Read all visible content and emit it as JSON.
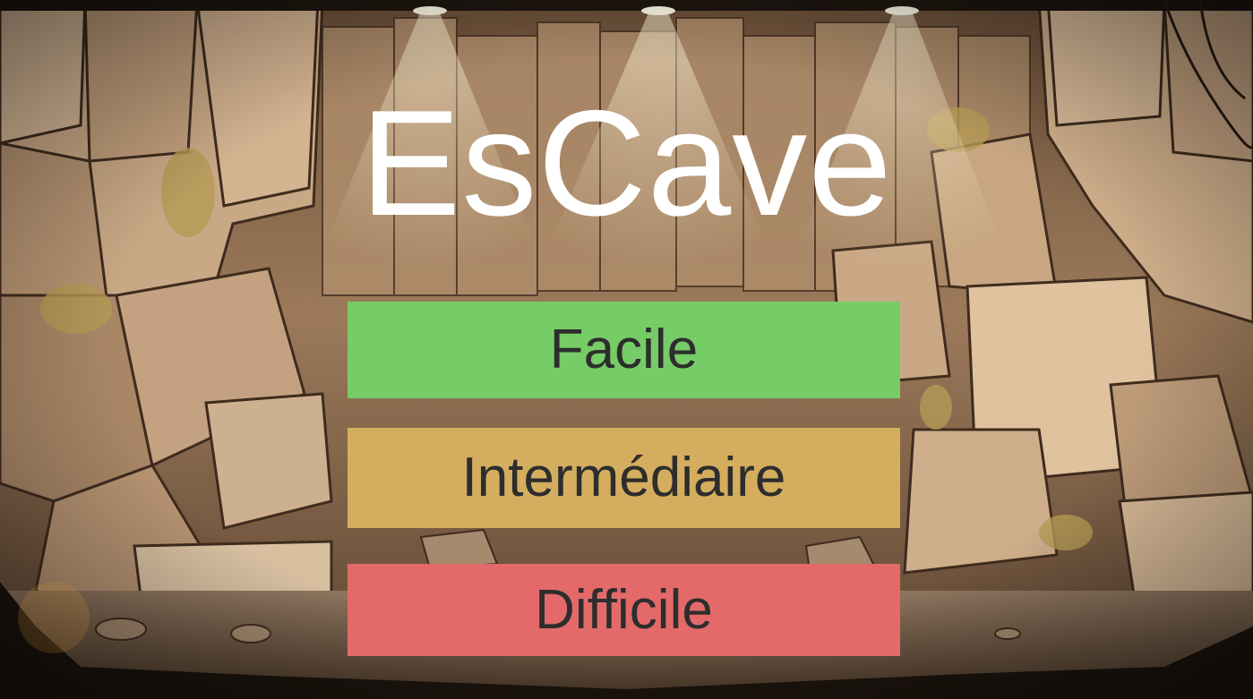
{
  "game": {
    "title": "EsCave"
  },
  "menu": {
    "buttons": [
      {
        "label": "Facile",
        "color": "#76cc66"
      },
      {
        "label": "Intermédiaire",
        "color": "#d4ae5e"
      },
      {
        "label": "Difficile",
        "color": "#e46a6a"
      }
    ]
  },
  "theme": {
    "title_color": "#ffffff",
    "button_text_color": "#2d2d2d",
    "background_icon": "cave-background-illustration"
  }
}
